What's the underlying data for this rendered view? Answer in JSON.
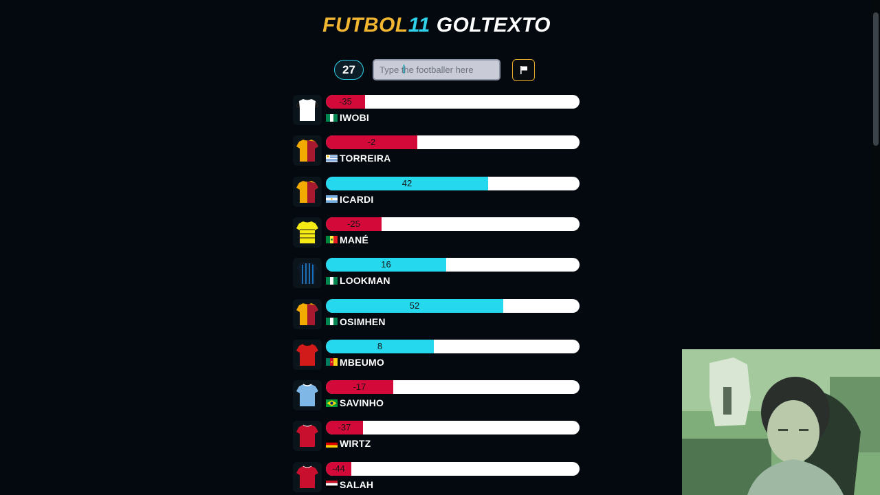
{
  "header": {
    "title_part1": "FUTBOL",
    "title_part2": "11",
    "title_part3": "GOLTEXTO"
  },
  "controls": {
    "counter": "27",
    "search_placeholder": "Type the footballer here",
    "flag_icon": "flag-icon"
  },
  "guesses": [
    {
      "name": "IWOBI",
      "value": -35,
      "label": "-35",
      "fraction": 0.155,
      "flag": "nigeria",
      "shirt": "white"
    },
    {
      "name": "TORREIRA",
      "value": -2,
      "label": "-2",
      "fraction": 0.36,
      "flag": "uruguay",
      "shirt": "galatasaray"
    },
    {
      "name": "ICARDI",
      "value": 42,
      "label": "42",
      "fraction": 0.64,
      "flag": "argentina",
      "shirt": "galatasaray"
    },
    {
      "name": "MANÉ",
      "value": -25,
      "label": "-25",
      "fraction": 0.22,
      "flag": "senegal",
      "shirt": "yellow"
    },
    {
      "name": "LOOKMAN",
      "value": 16,
      "label": "16",
      "fraction": 0.475,
      "flag": "nigeria",
      "shirt": "atalanta"
    },
    {
      "name": "OSIMHEN",
      "value": 52,
      "label": "52",
      "fraction": 0.7,
      "flag": "nigeria",
      "shirt": "galatasaray"
    },
    {
      "name": "MBEUMO",
      "value": 8,
      "label": "8",
      "fraction": 0.425,
      "flag": "cameroon",
      "shirt": "red-black"
    },
    {
      "name": "SAVINHO",
      "value": -17,
      "label": "-17",
      "fraction": 0.265,
      "flag": "brazil",
      "shirt": "skyblue"
    },
    {
      "name": "WIRTZ",
      "value": -37,
      "label": "-37",
      "fraction": 0.145,
      "flag": "germany",
      "shirt": "liverpool"
    },
    {
      "name": "SALAH",
      "value": -44,
      "label": "-44",
      "fraction": 0.1,
      "flag": "egypt",
      "shirt": "liverpool"
    }
  ],
  "colors": {
    "background": "#03090f",
    "negative": "#d3093a",
    "positive": "#25d8ee",
    "accent_gold": "#f2b632",
    "accent_cyan": "#2fd2ea"
  }
}
